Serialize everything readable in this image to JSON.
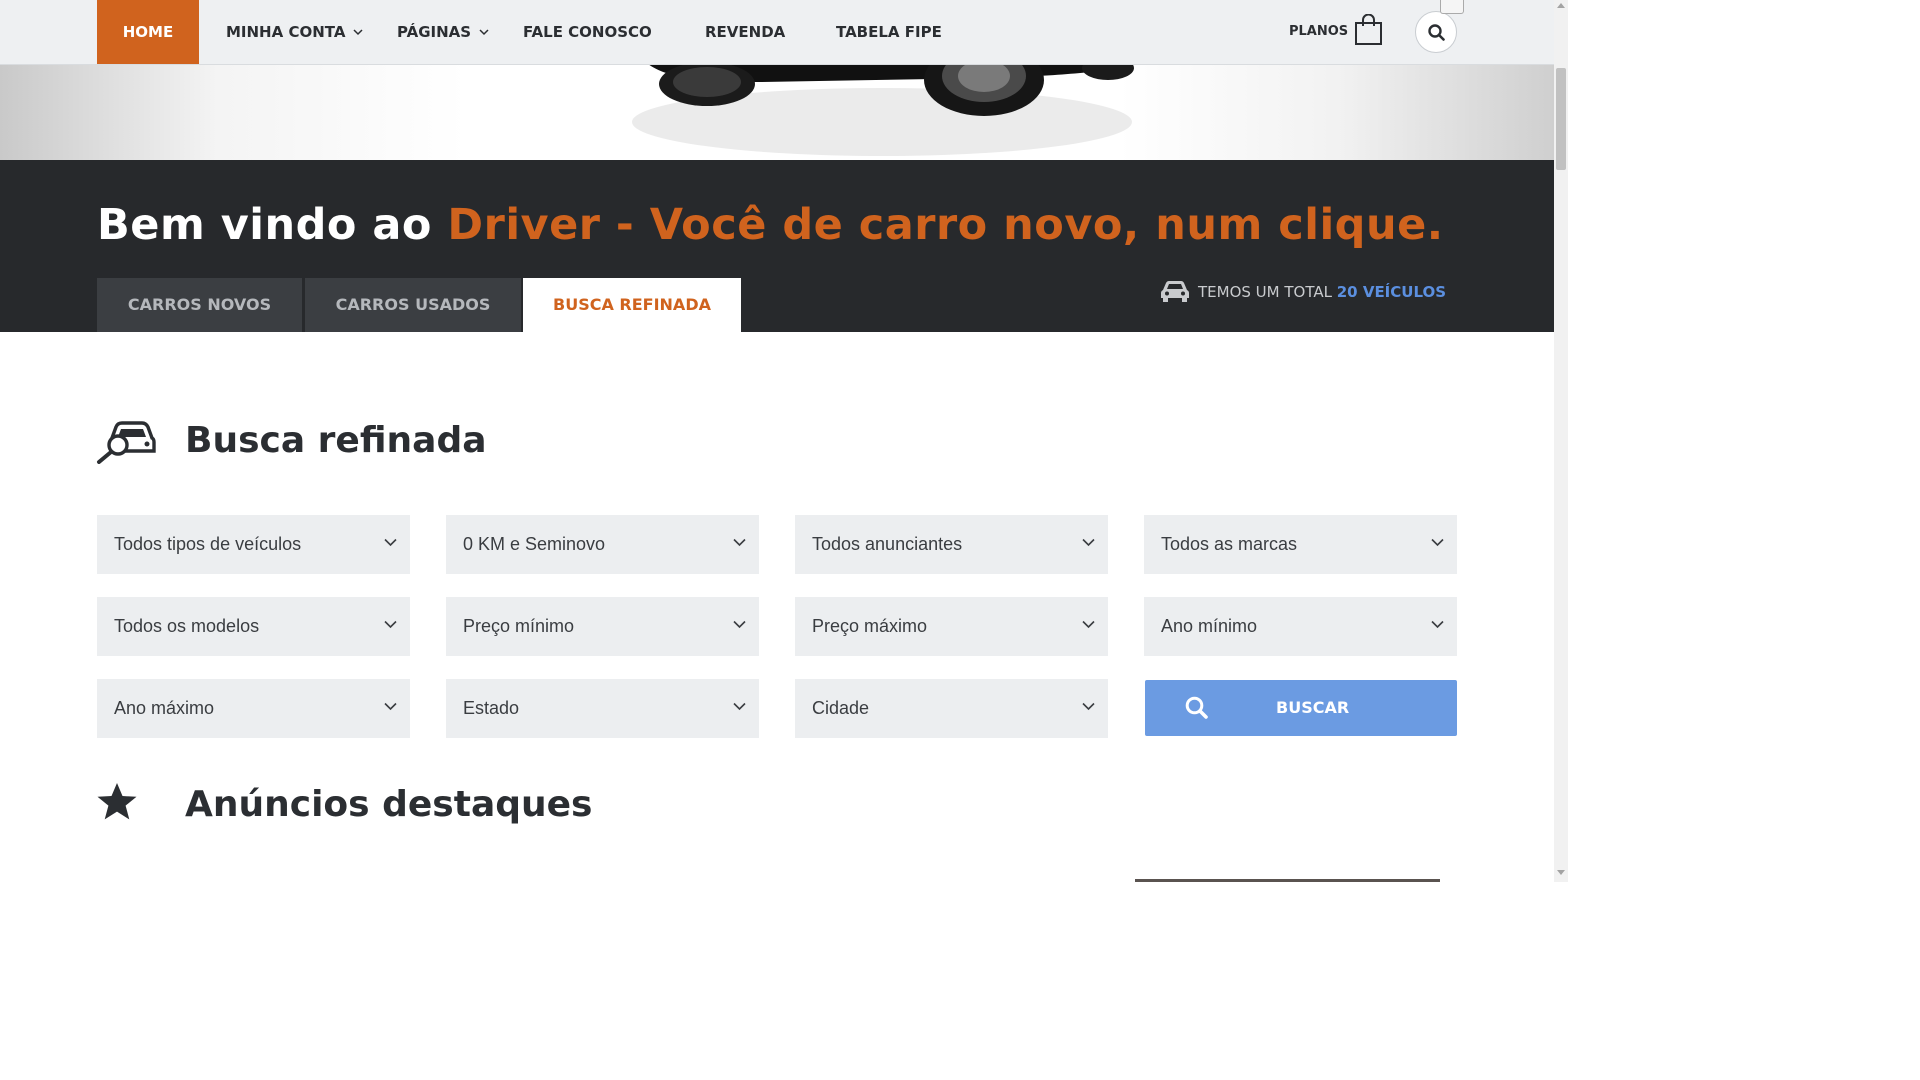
{
  "nav": {
    "items": [
      {
        "label": "HOME",
        "active": true
      },
      {
        "label": "MINHA CONTA",
        "dropdown": true
      },
      {
        "label": "PÁGINAS",
        "dropdown": true
      },
      {
        "label": "FALE CONOSCO"
      },
      {
        "label": "REVENDA"
      },
      {
        "label": "TABELA FIPE"
      }
    ],
    "plans_label": "PLANOS",
    "accent_color": "#d0631e"
  },
  "banner": {
    "welcome_prefix": "Bem vindo ao ",
    "welcome_highlight": "Driver - Você de carro novo, num clique.",
    "tabs": [
      {
        "label": "CARROS NOVOS",
        "active": false
      },
      {
        "label": "CARROS USADOS",
        "active": false
      },
      {
        "label": "BUSCA REFINADA",
        "active": true
      }
    ],
    "total_prefix": "TEMOS UM TOTAL ",
    "total_count": "20 VEÍCULOS"
  },
  "search": {
    "title": "Busca refinada",
    "selects": [
      "Todos tipos de veículos",
      "0 KM e Seminovo",
      "Todos anunciantes",
      "Todos as marcas",
      "Todos os modelos",
      "Preço mínimo",
      "Preço máximo",
      "Ano mínimo",
      "Ano máximo",
      "Estado",
      "Cidade"
    ],
    "button_label": "BUSCAR",
    "button_color": "#6b9be2"
  },
  "featured": {
    "title": "Anúncios destaques"
  }
}
